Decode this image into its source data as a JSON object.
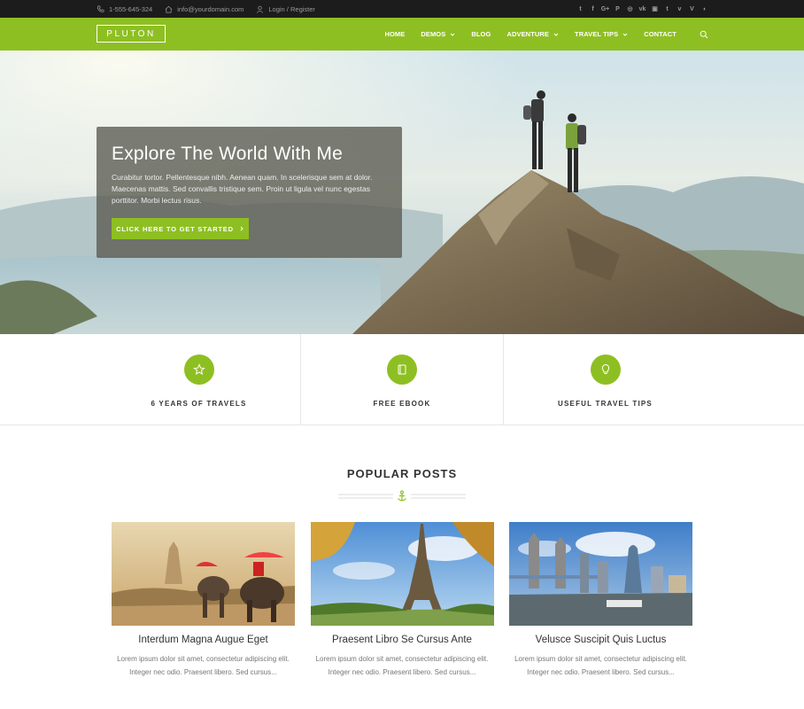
{
  "topbar": {
    "phone": "1-555-645-324",
    "email": "info@yourdomain.com",
    "login": "Login / Register",
    "social_icons": [
      "twitter-icon",
      "facebook-icon",
      "google-plus-icon",
      "pinterest-icon",
      "dribbble-icon",
      "vk-icon",
      "instagram-icon",
      "tumblr-icon",
      "vimeo-icon",
      "vine-icon",
      "rss-icon"
    ]
  },
  "nav": {
    "logo": "PLUTON",
    "items": [
      "HOME",
      "DEMOS",
      "BLOG",
      "ADVENTURE",
      "TRAVEL TIPS",
      "CONTACT"
    ]
  },
  "hero": {
    "title": "Explore The World With Me",
    "text": "Curabitur tortor. Pellentesque nibh. Aenean quam. In scelerisque sem at dolor. Maecenas mattis. Sed convallis tristique sem. Proin ut ligula vel nunc egestas porttitor. Morbi lectus risus.",
    "button": "CLICK HERE TO GET STARTED"
  },
  "features": [
    {
      "label": "6 YEARS OF TRAVELS",
      "icon": "star-icon"
    },
    {
      "label": "FREE EBOOK",
      "icon": "book-icon"
    },
    {
      "label": "USEFUL TRAVEL TIPS",
      "icon": "lightbulb-icon"
    }
  ],
  "popular": {
    "title": "POPULAR POSTS",
    "posts": [
      {
        "title": "Interdum Magna Augue Eget",
        "excerpt": "Lorem ipsum dolor sit amet, consectetur adipiscing elit. Integer nec odio. Praesent libero. Sed cursus..."
      },
      {
        "title": "Praesent Libro Se Cursus Ante",
        "excerpt": "Lorem ipsum dolor sit amet, consectetur adipiscing elit. Integer nec odio. Praesent libero. Sed cursus..."
      },
      {
        "title": "Velusce Suscipit Quis Luctus",
        "excerpt": "Lorem ipsum dolor sit amet, consectetur adipiscing elit. Integer nec odio. Praesent libero. Sed cursus..."
      }
    ]
  },
  "colors": {
    "accent": "#8ebf22",
    "topbar": "#1c1c1c"
  }
}
